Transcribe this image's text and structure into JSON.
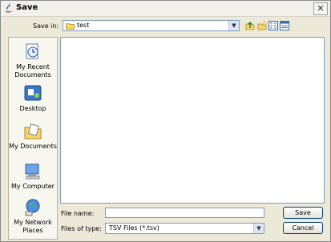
{
  "window": {
    "title": "Save",
    "close_glyph": "✕"
  },
  "toolbar": {
    "save_in_label": "Save in:",
    "save_in_value": "test",
    "icons": [
      "up-folder-icon",
      "new-folder-icon",
      "list-view-icon",
      "details-view-icon"
    ]
  },
  "places": [
    {
      "label": "My Recent Documents",
      "icon": "recent-documents-icon"
    },
    {
      "label": "Desktop",
      "icon": "desktop-icon"
    },
    {
      "label": "My Documents",
      "icon": "my-documents-icon"
    },
    {
      "label": "My Computer",
      "icon": "my-computer-icon"
    },
    {
      "label": "My Network Places",
      "icon": "network-places-icon"
    }
  ],
  "form": {
    "file_name_label": "File name:",
    "file_name_value": "",
    "files_of_type_label": "Files of type:",
    "files_of_type_value": "TSV Files (*.tsv)"
  },
  "buttons": {
    "save": "Save",
    "cancel": "Cancel"
  },
  "colors": {
    "accent": "#7f9db9",
    "panel": "#ece9d8"
  }
}
